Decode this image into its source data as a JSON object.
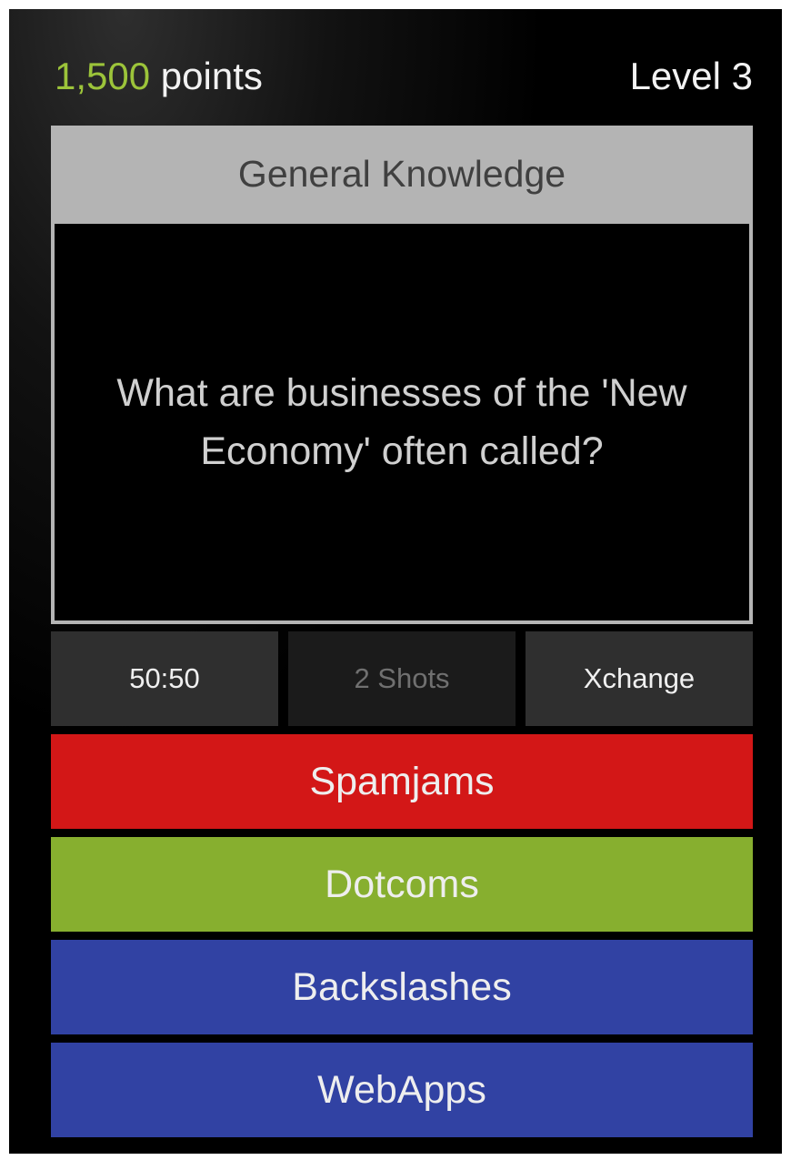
{
  "header": {
    "points_value": "1,500",
    "points_label": "points",
    "level": "Level 3"
  },
  "question": {
    "category": "General Knowledge",
    "text": "What are businesses of the 'New Economy' often called?"
  },
  "lifelines": [
    {
      "label": "50:50",
      "state": "available"
    },
    {
      "label": "2 Shots",
      "state": "used"
    },
    {
      "label": "Xchange",
      "state": "available"
    }
  ],
  "answers": [
    {
      "label": "Spamjams",
      "color": "#d31717"
    },
    {
      "label": "Dotcoms",
      "color": "#87af2f"
    },
    {
      "label": "Backslashes",
      "color": "#3142a3"
    },
    {
      "label": "WebApps",
      "color": "#3142a3"
    }
  ],
  "colors": {
    "points_accent": "#9cc43a",
    "background": "#000000",
    "category_bar": "#b4b4b4"
  }
}
